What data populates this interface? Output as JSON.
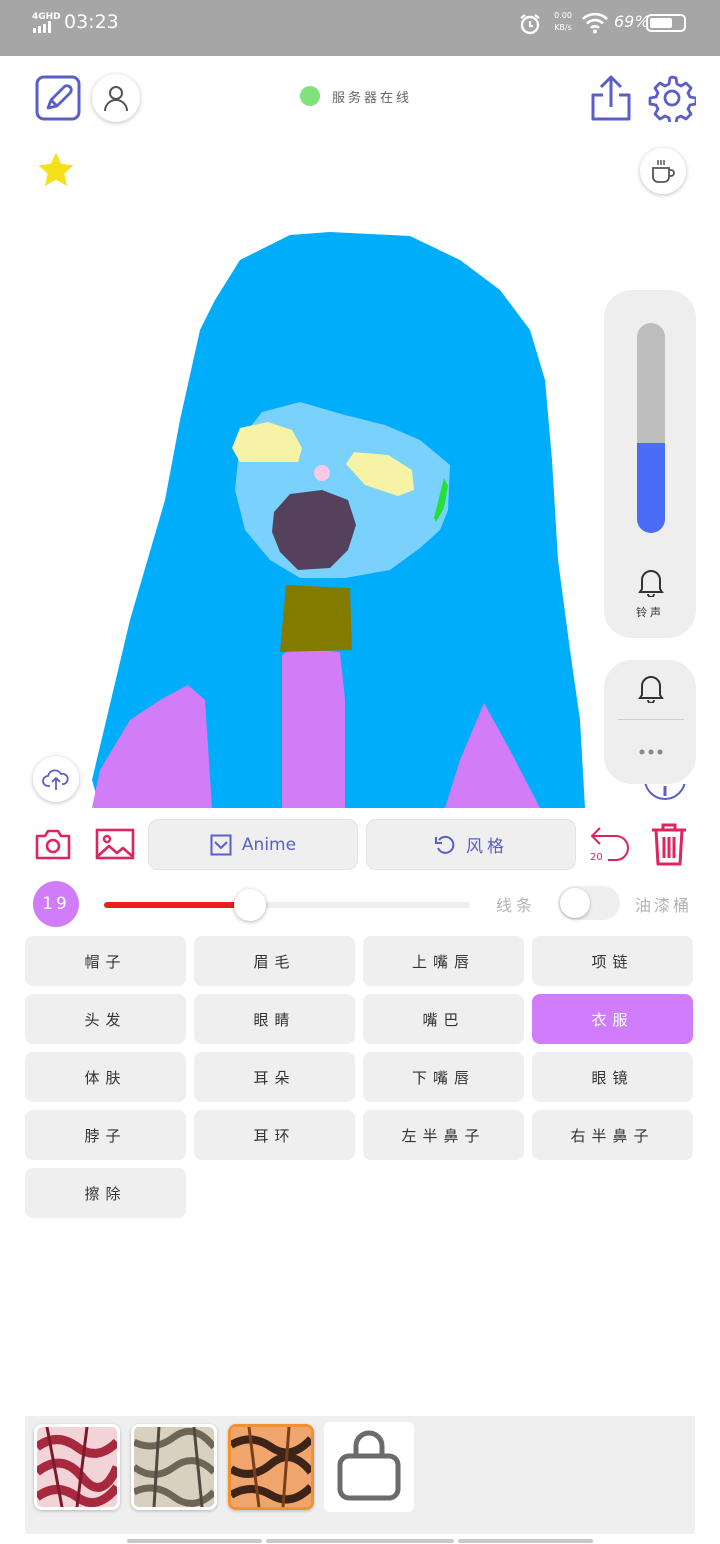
{
  "status_bar": {
    "network": "4GHD",
    "time": "03:23",
    "speed_value": "0.00",
    "speed_unit": "KB/s",
    "battery": "69%",
    "battery_level": 0.69
  },
  "header": {
    "server_status": "服务器在线",
    "server_status_color": "#7fe37a"
  },
  "volume_panel": {
    "level": 0.43,
    "label": "铃声"
  },
  "toolbar": {
    "anime_label": "Anime",
    "style_label": "风格",
    "undo_count": "20"
  },
  "brush": {
    "size": "19",
    "slider_value": 0.4,
    "line_label": "线条",
    "bucket_label": "油漆桶"
  },
  "parts": [
    {
      "label": "帽子",
      "selected": false
    },
    {
      "label": "眉毛",
      "selected": false
    },
    {
      "label": "上嘴唇",
      "selected": false
    },
    {
      "label": "项链",
      "selected": false
    },
    {
      "label": "头发",
      "selected": false
    },
    {
      "label": "眼睛",
      "selected": false
    },
    {
      "label": "嘴巴",
      "selected": false
    },
    {
      "label": "衣服",
      "selected": true
    },
    {
      "label": "体肤",
      "selected": false
    },
    {
      "label": "耳朵",
      "selected": false
    },
    {
      "label": "下嘴唇",
      "selected": false
    },
    {
      "label": "眼镜",
      "selected": false
    },
    {
      "label": "脖子",
      "selected": false
    },
    {
      "label": "耳环",
      "selected": false
    },
    {
      "label": "左半鼻子",
      "selected": false
    },
    {
      "label": "右半鼻子",
      "selected": false
    },
    {
      "label": "擦除",
      "selected": false
    }
  ],
  "colors": {
    "accent": "#5a5fc8",
    "danger": "#e0245e",
    "selected": "#cf7dfb",
    "slider": "#ee1c1c",
    "volume": "#4a6cf7"
  }
}
